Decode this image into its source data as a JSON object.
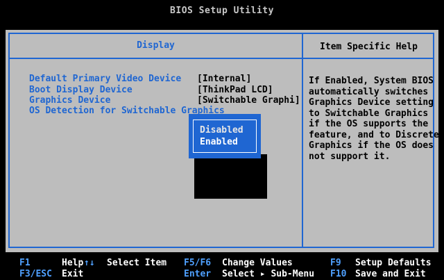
{
  "window": {
    "title": "BIOS Setup Utility"
  },
  "panel": {
    "left_title": "Display",
    "right_title": "Item Specific Help"
  },
  "settings": [
    {
      "label": "Default Primary Video Device",
      "value": "[Internal]"
    },
    {
      "label": "Boot Display Device",
      "value": "[ThinkPad LCD]"
    },
    {
      "label": "Graphics Device",
      "value": "[Switchable Graphi]"
    },
    {
      "label": "OS Detection for Switchable Graphics",
      "value": ""
    }
  ],
  "popup": {
    "options": [
      "Disabled",
      "Enabled"
    ],
    "selected": "Enabled"
  },
  "help_lines": [
    "If Enabled, System BIOS",
    "automatically switches",
    "Graphics Device setting",
    "to Switchable Graphics",
    "if the OS supports the",
    "feature, and to Discrete",
    "Graphics if the OS does",
    "not support it."
  ],
  "footer": {
    "f1_key": "F1",
    "f1_desc": "Help",
    "arrows_key": "↑↓",
    "arrows_desc": "Select Item",
    "f5f6_key": "F5/F6",
    "f5f6_desc": "Change Values",
    "f9_key": "F9",
    "f9_desc": "Setup Defaults",
    "f3_key": "F3/ESC",
    "f3_desc": "Exit",
    "enter_key": "Enter",
    "enter_desc": "Select ▸ Sub-Menu",
    "f10_key": "F10",
    "f10_desc": "Save and Exit"
  },
  "colors": {
    "accent": "#1f66d2",
    "panel_bg": "#bdbdbd",
    "background": "#000000"
  }
}
